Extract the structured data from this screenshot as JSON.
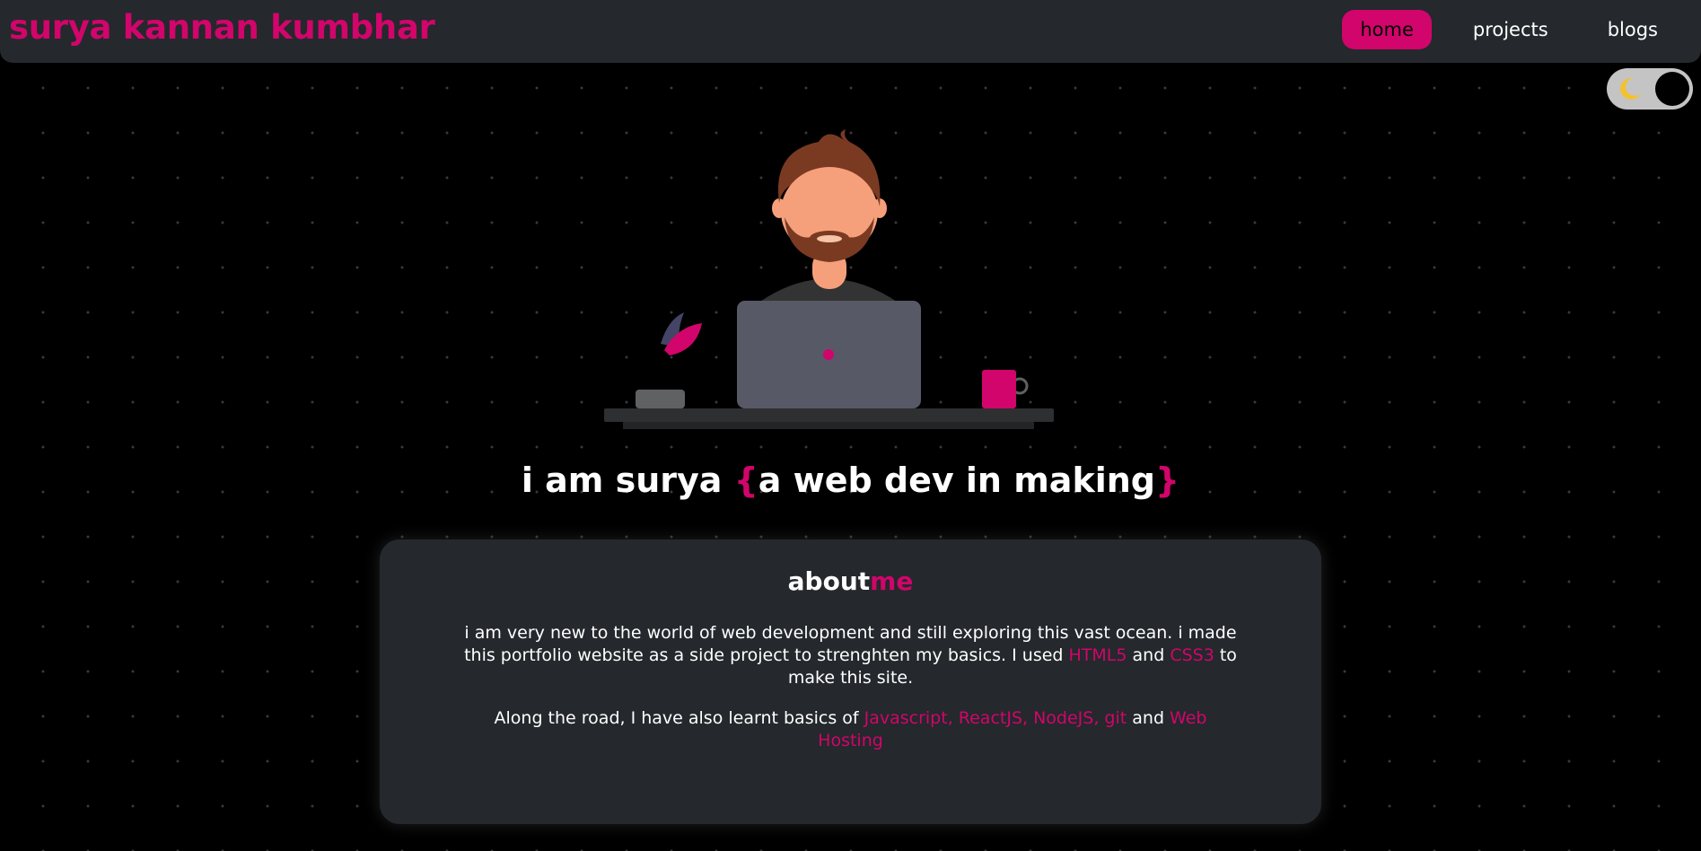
{
  "colors": {
    "accent": "#d1056b",
    "navbar_bg": "#25282c",
    "card_bg": "#25282c",
    "page_bg": "#000000",
    "text": "#ffffff",
    "toggle_track": "#c4c4c4",
    "moon": "#f2c230"
  },
  "nav": {
    "brand": "surya kannan kumbhar",
    "links": [
      {
        "label": "home",
        "active": true
      },
      {
        "label": "projects",
        "active": false
      },
      {
        "label": "blogs",
        "active": false
      }
    ]
  },
  "theme_toggle": {
    "icon": "moon-icon",
    "mode": "dark"
  },
  "hero": {
    "illustration": "developer-at-laptop-illustration",
    "tagline_plain": "i am surya ",
    "tagline_brace_open": "{",
    "tagline_highlight": "a web dev in making",
    "tagline_brace_close": "}"
  },
  "about": {
    "title_main": "about",
    "title_accent": "me",
    "p1_text_a": "i am very new to the world of web development and still exploring this vast ocean. i made this portfolio website as a side project to strenghten my basics. I used ",
    "p1_html5": "HTML5",
    "p1_and": " and ",
    "p1_css3": "CSS3",
    "p1_text_b": " to make this site.",
    "p2_text_a": "Along the road, I have also learnt basics of ",
    "p2_skills": "Javascript, ReactJS, NodeJS, git",
    "p2_and": " and ",
    "p2_hosting": "Web Hosting"
  }
}
